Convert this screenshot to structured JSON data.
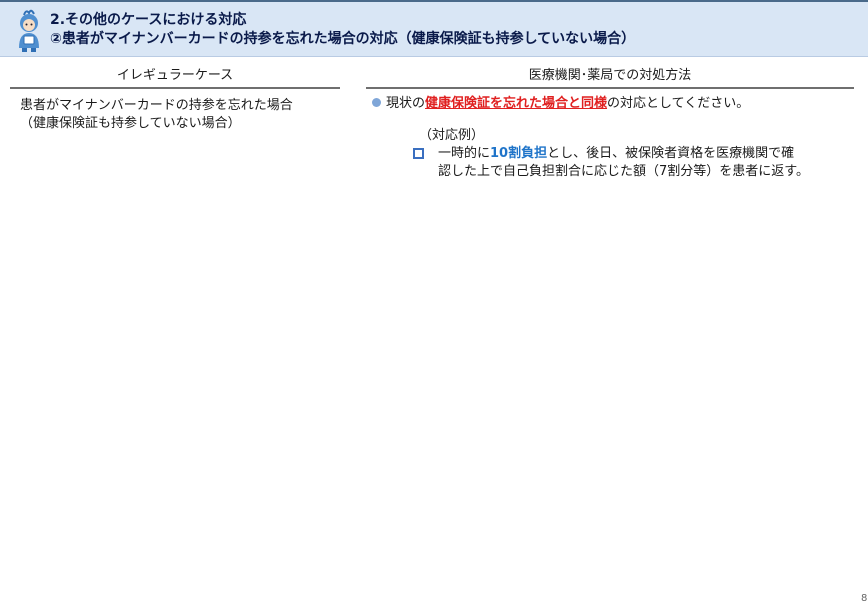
{
  "header": {
    "line1": "2.その他のケースにおける対応",
    "line2": "②患者がマイナンバーカードの持参を忘れた場合の対応（健康保険証も持参していない場合）"
  },
  "columns": {
    "left_heading": "イレギュラーケース",
    "right_heading": "医療機関･薬局での対処方法"
  },
  "left": {
    "line1": "患者がマイナンバーカードの持参を忘れた場合",
    "line2": "（健康保険証も持参していない場合）"
  },
  "right": {
    "bullet": {
      "prefix": "現状の",
      "highlight": "健康保険証を忘れた場合と同様",
      "suffix": "の対応としてください。"
    },
    "example_label": "（対応例）",
    "sub_item": {
      "prefix": "一時的に",
      "highlight": "10割負担",
      "line1_rest": "とし、後日、被保険者資格を医療機関で確",
      "line2": "認した上で自己負担割合に応じた額（7割分等）を患者に返す。"
    }
  },
  "page_number": "8",
  "colors": {
    "header_bg": "#d9e6f5",
    "emphasis_red": "#e02020",
    "emphasis_blue": "#1f74c9",
    "bullet_dot": "#7fa6d8",
    "checkbox_blue": "#3a6fc0"
  },
  "icons": {
    "header_icon": "mascot-icon",
    "bullet": "bullet-dot-icon",
    "sub_bullet": "square-bullet-icon"
  }
}
